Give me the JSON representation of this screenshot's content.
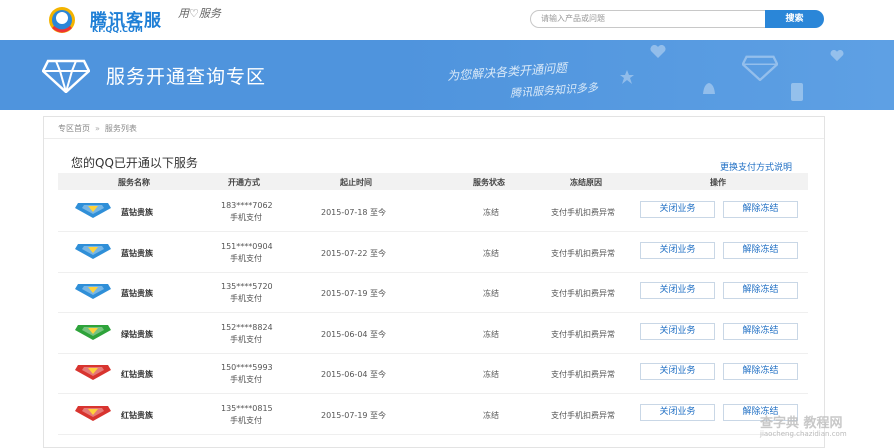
{
  "header": {
    "logo_title": "腾讯客服",
    "logo_sub": "KF.QQ.COM",
    "logo_slogan": "用♡服务",
    "search_placeholder": "请输入产品或问题",
    "search_button": "搜索"
  },
  "banner": {
    "title": "服务开通查询专区",
    "slogan_line1": "为您解决各类开通问题",
    "slogan_line2": "腾讯服务知识多多"
  },
  "breadcrumb": [
    "专区首页",
    "服务列表"
  ],
  "section_title": "您的QQ已开通以下服务",
  "pay_link": "更换支付方式说明",
  "table": {
    "headers": [
      "服务名称",
      "开通方式",
      "起止时间",
      "服务状态",
      "冻结原因",
      "操作"
    ],
    "rows": [
      {
        "name": "蓝钻贵族",
        "icon": "blue-diamond-icon",
        "icon_color": "#2f8fd8",
        "account": "183****7062",
        "method": "手机支付",
        "date": "2015-07-18 至今",
        "status": "冻结",
        "reason": "支付手机扣费异常",
        "btn1": "关闭业务",
        "btn2": "解除冻结"
      },
      {
        "name": "蓝钻贵族",
        "icon": "blue-diamond-icon",
        "icon_color": "#2f8fd8",
        "account": "151****0904",
        "method": "手机支付",
        "date": "2015-07-22 至今",
        "status": "冻结",
        "reason": "支付手机扣费异常",
        "btn1": "关闭业务",
        "btn2": "解除冻结"
      },
      {
        "name": "蓝钻贵族",
        "icon": "blue-diamond-icon",
        "icon_color": "#2f8fd8",
        "account": "135****5720",
        "method": "手机支付",
        "date": "2015-07-19 至今",
        "status": "冻结",
        "reason": "支付手机扣费异常",
        "btn1": "关闭业务",
        "btn2": "解除冻结"
      },
      {
        "name": "绿钻贵族",
        "icon": "green-diamond-icon",
        "icon_color": "#2ea33a",
        "account": "152****8824",
        "method": "手机支付",
        "date": "2015-06-04 至今",
        "status": "冻结",
        "reason": "支付手机扣费异常",
        "btn1": "关闭业务",
        "btn2": "解除冻结"
      },
      {
        "name": "红钻贵族",
        "icon": "red-diamond-icon",
        "icon_color": "#d8342f",
        "account": "150****5993",
        "method": "手机支付",
        "date": "2015-06-04 至今",
        "status": "冻结",
        "reason": "支付手机扣费异常",
        "btn1": "关闭业务",
        "btn2": "解除冻结"
      },
      {
        "name": "红钻贵族",
        "icon": "red-diamond-icon",
        "icon_color": "#d8342f",
        "account": "135****0815",
        "method": "手机支付",
        "date": "2015-07-19 至今",
        "status": "冻结",
        "reason": "支付手机扣费异常",
        "btn1": "关闭业务",
        "btn2": "解除冻结"
      }
    ]
  },
  "watermark": "查字典 教程网",
  "watermark_sub": "jiaocheng.chazidian.com",
  "colors": {
    "brand": "#1f7fd6",
    "banner": "#4f94dd",
    "link": "#1f6fc4"
  }
}
